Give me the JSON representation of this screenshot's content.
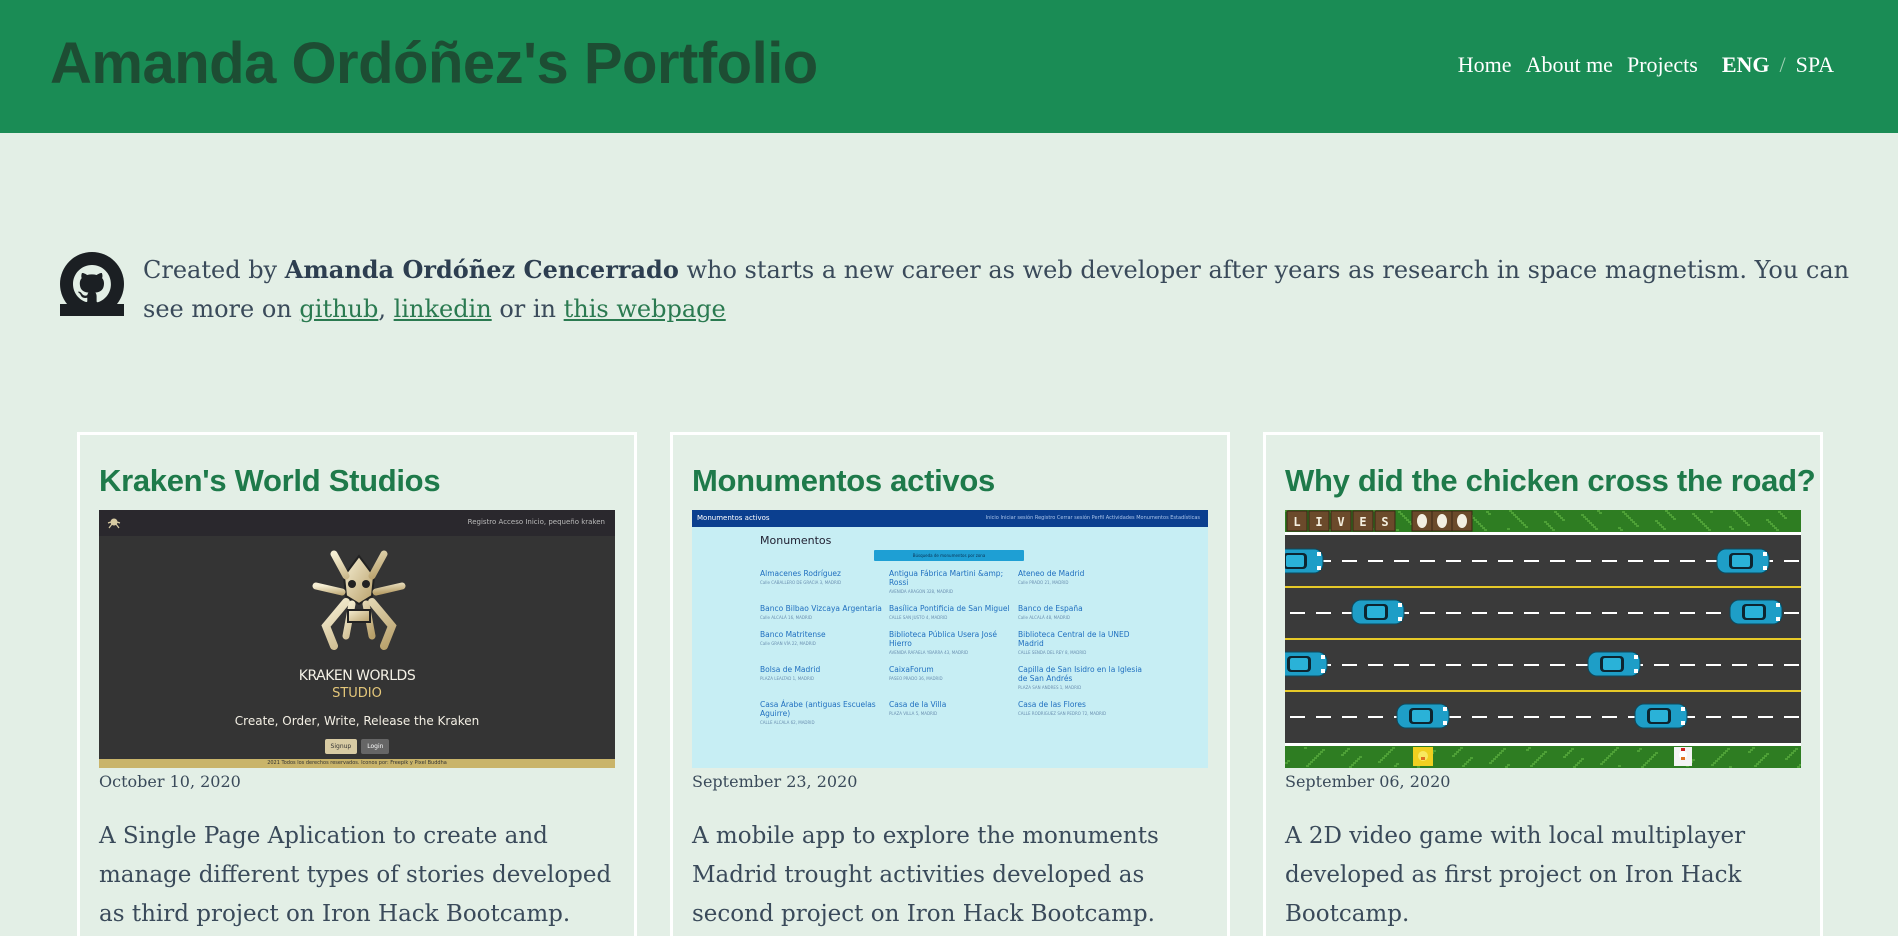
{
  "header": {
    "title": "Amanda Ordóñez's Portfolio",
    "nav": {
      "home": "Home",
      "about": "About me",
      "projects": "Projects"
    },
    "lang": {
      "eng": "ENG",
      "sep": "/",
      "spa": "SPA"
    }
  },
  "intro": {
    "prefix": "Created by ",
    "name": "Amanda Ordóñez Cencerrado",
    "middle": " who starts a new career as web developer after years as research in space magnetism. You can see more on ",
    "link_github": "github",
    "comma": ", ",
    "link_linkedin": "linkedin",
    "or_in": " or in ",
    "link_web": "this webpage"
  },
  "projects": [
    {
      "title": "Kraken's World Studios",
      "date": "October 10, 2020",
      "description": "A Single Page Aplication to create and manage different types of stories developed as third project on Iron Hack Bootcamp.",
      "screenshot": {
        "nav_links": "Registro    Acceso    Inicio, pequeño kraken",
        "brand_line1": "KRAKEN WORLDS",
        "brand_line2": "STUDIO",
        "tagline": "Create, Order, Write, Release the Kraken",
        "signup": "Signup",
        "login": "Login",
        "footer": "2021 Todos los derechos reservados. Iconos por: Freepik y Pixel Buddha"
      }
    },
    {
      "title": "Monumentos activos",
      "date": "September 23, 2020",
      "description": "A mobile app to explore the monuments Madrid trought activities developed as second project on Iron Hack Bootcamp.",
      "screenshot": {
        "brand": "Monumentos activos",
        "nav_links": "Inicio   Iniciar sesión   Registro   Cerrar sesión   Perfil   Actividades   Monumentos   Estadísticas",
        "heading": "Monumentos",
        "search": "Búsqueda de monumentos por zona",
        "items": [
          {
            "name": "Almacenes Rodríguez",
            "addr": "Calle CABALLERO DE GRACIA 3, MADRID"
          },
          {
            "name": "Antigua Fábrica Martini &amp; Rossi",
            "addr": "AVENIDA ARAGON 328, MADRID"
          },
          {
            "name": "Ateneo de Madrid",
            "addr": "Calle PRADO 21, MADRID"
          },
          {
            "name": "Banco Bilbao Vizcaya Argentaria",
            "addr": "Calle ALCALÁ 16, MADRID"
          },
          {
            "name": "Basílica Pontificia de San Miguel",
            "addr": "CALLE SAN JUSTO 4, MADRID"
          },
          {
            "name": "Banco de España",
            "addr": "Calle ALCALÁ 48, MADRID"
          },
          {
            "name": "Banco Matritense",
            "addr": "Calle GRAN VÍA 22, MADRID"
          },
          {
            "name": "Biblioteca Pública Usera José Hierro",
            "addr": "AVENIDA RAFAELA YBARRA 43, MADRID"
          },
          {
            "name": "Biblioteca Central de la UNED Madrid",
            "addr": "CALLE SENDA DEL REY 8, MADRID"
          },
          {
            "name": "Bolsa de Madrid",
            "addr": "PLAZA LEALTAD 1, MADRID"
          },
          {
            "name": "CaixaForum",
            "addr": "PASEO PRADO 36, MADRID"
          },
          {
            "name": "Capilla de San Isidro en la Iglesia de San Andrés",
            "addr": "PLAZA SAN ANDRES 1, MADRID"
          },
          {
            "name": "Casa Árabe (antiguas Escuelas Aguirre)",
            "addr": "CALLE ALCALA 62, MADRID"
          },
          {
            "name": "Casa de la Villa",
            "addr": "PLAZA VILLA 5, MADRID"
          },
          {
            "name": "Casa de las Flores",
            "addr": "CALLE RODRIGUEZ SAN PEDRO 72, MADRID"
          }
        ]
      }
    },
    {
      "title": "Why did the chicken cross the road?",
      "date": "September 06, 2020",
      "description": "A 2D video game with local multiplayer developed as first project on Iron Hack Bootcamp.",
      "screenshot": {
        "lives_letters": [
          "L",
          "I",
          "V",
          "E",
          "S"
        ]
      }
    }
  ],
  "colors": {
    "header_bg": "#1a8c55",
    "title_color": "#1d4d33",
    "page_bg": "#e3efe6",
    "accent_green": "#1e7a4a"
  }
}
